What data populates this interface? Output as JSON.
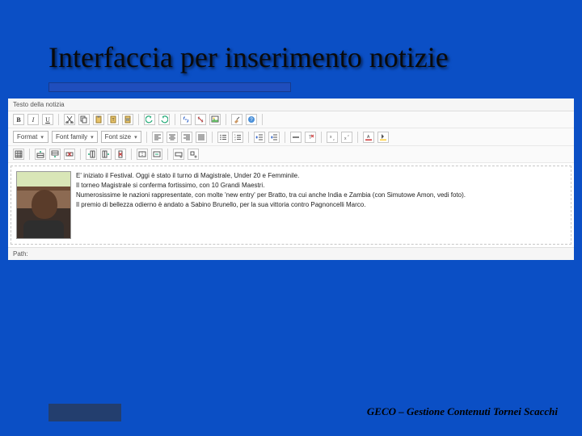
{
  "slide": {
    "title": "Interfaccia per inserimento notizie",
    "footer": "GECO – Gestione Contenuti Tornei Scacchi"
  },
  "editor": {
    "panel_label": "Testo della notizia",
    "status_label": "Path:",
    "font_format_label": "Format",
    "font_family_label": "Font family",
    "font_size_label": "Font size",
    "body_lines": [
      "E' iniziato il Festival. Oggi è stato il turno di Magistrale, Under 20 e Femminile.",
      "Il torneo Magistrale si conferma fortissimo, con 10 Grandi Maestri.",
      "Numerosissime le nazioni rappresentate, con molte 'new entry' per Bratto, tra cui anche India e Zambia (con Simutowe Amon, vedi foto).",
      "Il premio di bellezza odierno è andato a Sabino Brunello, per la sua vittoria contro Pagnoncelli Marco."
    ]
  },
  "icons": {
    "bold": "B",
    "italic": "I",
    "underline": "U",
    "cut": "cut-icon",
    "copy": "copy-icon",
    "paste": "paste-icon",
    "undo": "undo-icon",
    "redo": "redo-icon",
    "link": "link-icon",
    "unlink": "unlink-icon",
    "image": "image-icon",
    "clean": "clean-icon",
    "help": "help-icon",
    "align_left": "align-left-icon",
    "align_center": "align-center-icon",
    "align_right": "align-right-icon",
    "align_justify": "align-justify-icon",
    "ul": "ul-icon",
    "ol": "ol-icon",
    "outdent": "outdent-icon",
    "indent": "indent-icon",
    "hr": "hr-icon",
    "removefmt": "removefmt-icon",
    "sub": "sub-icon",
    "sup": "sup-icon",
    "fgcolor": "fgcolor-icon",
    "bgcolor": "bgcolor-icon",
    "table": "table-icon",
    "row_before": "row-before-icon",
    "row_after": "row-after-icon",
    "row_del": "row-del-icon",
    "col_before": "col-before-icon",
    "col_after": "col-after-icon",
    "col_del": "col-del-icon",
    "split": "split-icon",
    "merge": "merge-icon",
    "rowprops": "rowprops-icon",
    "cellprops": "cellprops-icon"
  }
}
